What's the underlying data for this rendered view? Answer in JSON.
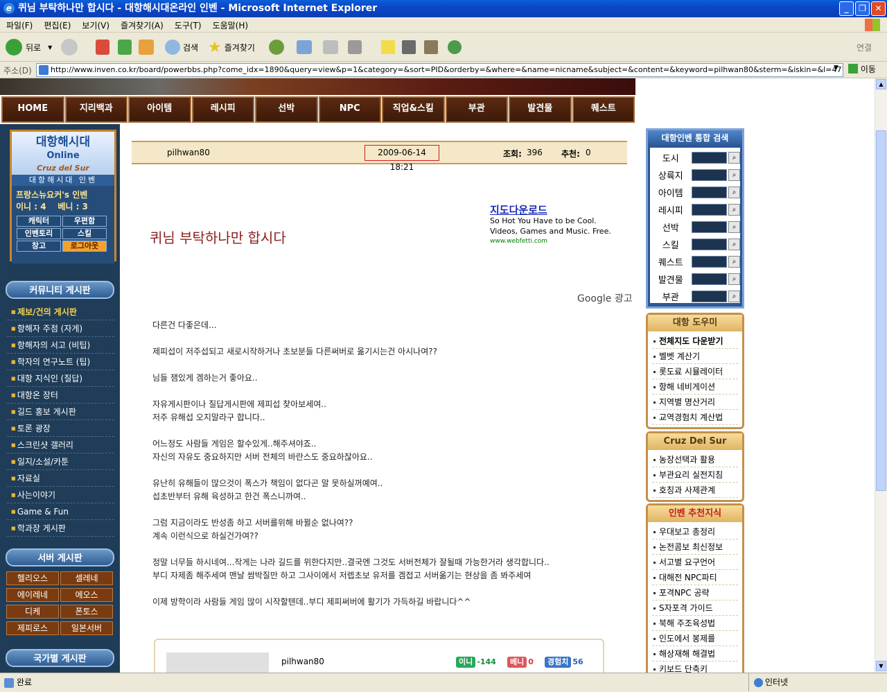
{
  "window": {
    "title": "퀴님 부탁하나만 합시다 - 대항해시대온라인 인벤 - Microsoft Internet Explorer"
  },
  "menubar": [
    "파일(F)",
    "편집(E)",
    "보기(V)",
    "즐겨찾기(A)",
    "도구(T)",
    "도움말(H)"
  ],
  "toolbar": {
    "back": "뒤로",
    "search": "검색",
    "favorites": "즐겨찾기",
    "links": "연결"
  },
  "address": {
    "label": "주소(D)",
    "url": "http://www.inven.co.kr/board/powerbbs.php?come_idx=1890&query=view&p=1&category=&sort=PID&orderby=&where=&name=nicname&subject=&content=&keyword=pilhwan80&sterm=&iskin=&l=4777",
    "go": "이동"
  },
  "status": {
    "left": "완료",
    "zone": "인터넷"
  },
  "nav": [
    "HOME",
    "지리백과",
    "아이템",
    "레시피",
    "선박",
    "NPC",
    "직업&스킬",
    "부관",
    "발견물",
    "퀘스트"
  ],
  "gamebox": {
    "logo": "대항해시대",
    "logo2": "Online",
    "logo3": "Cruz del Sur",
    "stripe": "대항해시대 인벤",
    "user": "프랑스뉴요커's 인벤",
    "ini": "이니 : 4",
    "beni": "베니 : 3",
    "buttons": [
      "캐릭터",
      "우편함",
      "인벤토리",
      "스킬",
      "창고",
      "로그아웃"
    ]
  },
  "community": {
    "title": "커뮤니티 게시판",
    "items": [
      "제보/건의 게시판",
      "항해자 주점 (자게)",
      "항해자의 서고 (비팁)",
      "학자의 연구노트 (팁)",
      "대항 지식인 (질답)",
      "대항온 장터",
      "길드 홍보 게시판",
      "토론 광장",
      "스크린샷 갤러리",
      "일지/소설/카툰",
      "자료실",
      "사는이야기",
      "Game & Fun",
      "학과장 게시판"
    ]
  },
  "servers": {
    "title": "서버 게시판",
    "items": [
      "헬리오스",
      "셀레네",
      "에이레네",
      "에오스",
      "디케",
      "폰토스",
      "제피로스",
      "일본서버"
    ]
  },
  "country": {
    "title": "국가별 게시판"
  },
  "post": {
    "author": "pilhwan80",
    "date": "2009-06-14 18:21",
    "views_label": "조회:",
    "views": "396",
    "rec_label": "추천:",
    "rec": "0",
    "title": "퀴님 부탁하나만 합시다",
    "body": [
      [
        "다른건 다좋은데..."
      ],
      [
        "제피섭이 저주섭되고 새로시작하거나 초보분들 다른써버로 옮기시는건 아시나여??"
      ],
      [
        "님들 잼있게 겜하는거 좋아요.."
      ],
      [
        "자유게시판이나 질답게시판에 제피섭 찾아보세여..",
        "저주 유해섭 오지말라구 합니다.."
      ],
      [
        "어느정도 사람들 게임은 할수있게..해주셔야죠..",
        "자신의 자유도 중요하지만 서버 전체의 바란스도 중요하잖아요.."
      ],
      [
        "유난히 유해들이 많으것이 폭스가 책임이 없다곤 말 못하실꺼예여..",
        "섭초반부터 유해 육성하고 한건 폭스니까여.."
      ],
      [
        "그럼 지금이라도 반성좀 하고 서버를위해 바뀔순 없나여??",
        "계속 이런식으로 하실건가여??"
      ],
      [
        "정말 너무들 하시네여...작게는 나라 길드를 위한다지만..결국엔 그것도 서버전체가 잘될때 가능한거라 생각합니다..",
        "부디 자제좀 해주세여 맨날 쌈박질만 하고 그사이에서 저렙초보 유저를 겜접고 서버옮기는 현상을 좀 봐주세여"
      ],
      [
        "이제 방학이라 사람들 게임 많이 시작할텐데..부디 제피써버에 활기가 가득하길 바랍니다^^"
      ]
    ]
  },
  "ad": {
    "link": "지도다운로드",
    "l1": "So Hot You Have to be Cool.",
    "l2": "Videos, Games and Music. Free.",
    "url": "www.webfetti.com",
    "google": "Google 광고"
  },
  "sig": {
    "nick": "pilhwan80",
    "ini_label": "이니",
    "ini": "-144",
    "beni_label": "베니",
    "beni": "0",
    "exp_label": "경험치",
    "exp": "56"
  },
  "search": {
    "title": "대항인벤 통합 검색",
    "rows": [
      "도시",
      "상륙지",
      "아이템",
      "레시피",
      "선박",
      "스킬",
      "퀘스트",
      "발견물",
      "부관"
    ]
  },
  "helper": {
    "title": "대항 도우미",
    "items": [
      "전체지도 다운받기",
      "벨벳 계산기",
      "롯도료 시뮬레이터",
      "항해 네비게이션",
      "지역별 명산거리",
      "교역경험치 계산법"
    ]
  },
  "cruz": {
    "title": "Cruz Del Sur",
    "items": [
      "농장선택과 활용",
      "부관요리 실전지침",
      "호칭과 사제관계"
    ]
  },
  "recommend": {
    "title": "인벤 추천지식",
    "items": [
      "우대보고 총정리",
      "논전콤보 최신정보",
      "서고별 요구언어",
      "대해전 NPC파티",
      "포격NPC 공략",
      "S자포격 가이드",
      "북해 주조육성법",
      "인도에서 봉제를",
      "해상재해 해결법",
      "키보드 단축키"
    ]
  }
}
